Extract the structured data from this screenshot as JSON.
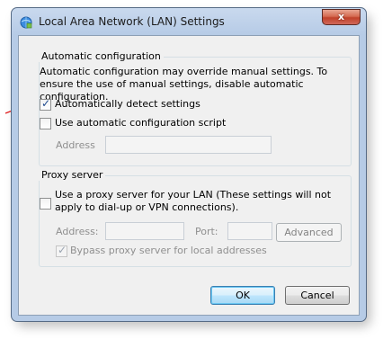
{
  "window": {
    "title": "Local Area Network (LAN) Settings",
    "close_label": "x"
  },
  "auto_config": {
    "group_label": "Automatic configuration",
    "description": "Automatic configuration may override manual settings.  To ensure the use of manual settings, disable automatic configuration.",
    "detect_label": "Automatically detect settings",
    "detect_checked": true,
    "script_label": "Use automatic configuration script",
    "script_checked": false,
    "address_label": "Address",
    "address_value": ""
  },
  "proxy": {
    "group_label": "Proxy server",
    "use_proxy_label": "Use a proxy server for your LAN (These settings will not apply to dial-up or VPN connections).",
    "use_proxy_checked": false,
    "address_label": "Address:",
    "address_value": "",
    "port_label": "Port:",
    "port_value": "",
    "advanced_label": "Advanced",
    "bypass_label": "Bypass proxy server for local addresses",
    "bypass_checked": true
  },
  "footer": {
    "ok_label": "OK",
    "cancel_label": "Cancel"
  },
  "colors": {
    "annotation_arrow": "#e02020",
    "default_button_border": "#3c7fb1"
  }
}
